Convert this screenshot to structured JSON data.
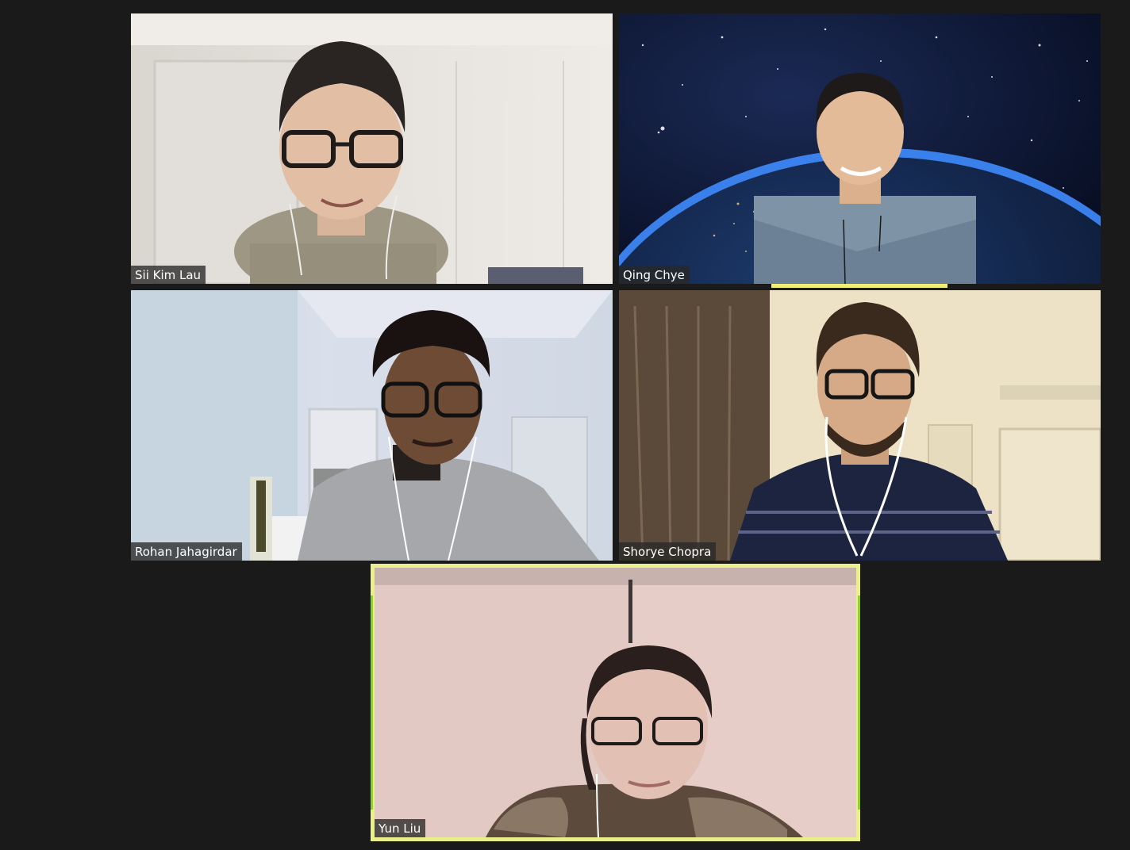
{
  "participants": [
    {
      "name": "Sii Kim Lau"
    },
    {
      "name": "Qing Chye"
    },
    {
      "name": "Rohan Jahagirdar"
    },
    {
      "name": "Shorye Chopra"
    },
    {
      "name": "Yun Liu"
    }
  ],
  "colors": {
    "background": "#1a1a1a",
    "active_speaker_border": "#e9ef8a",
    "active_speaker_edge": "#8fd12c",
    "name_tag_bg": "#282828",
    "name_tag_text": "#ffffff"
  },
  "active_speaker": "Yun Liu"
}
